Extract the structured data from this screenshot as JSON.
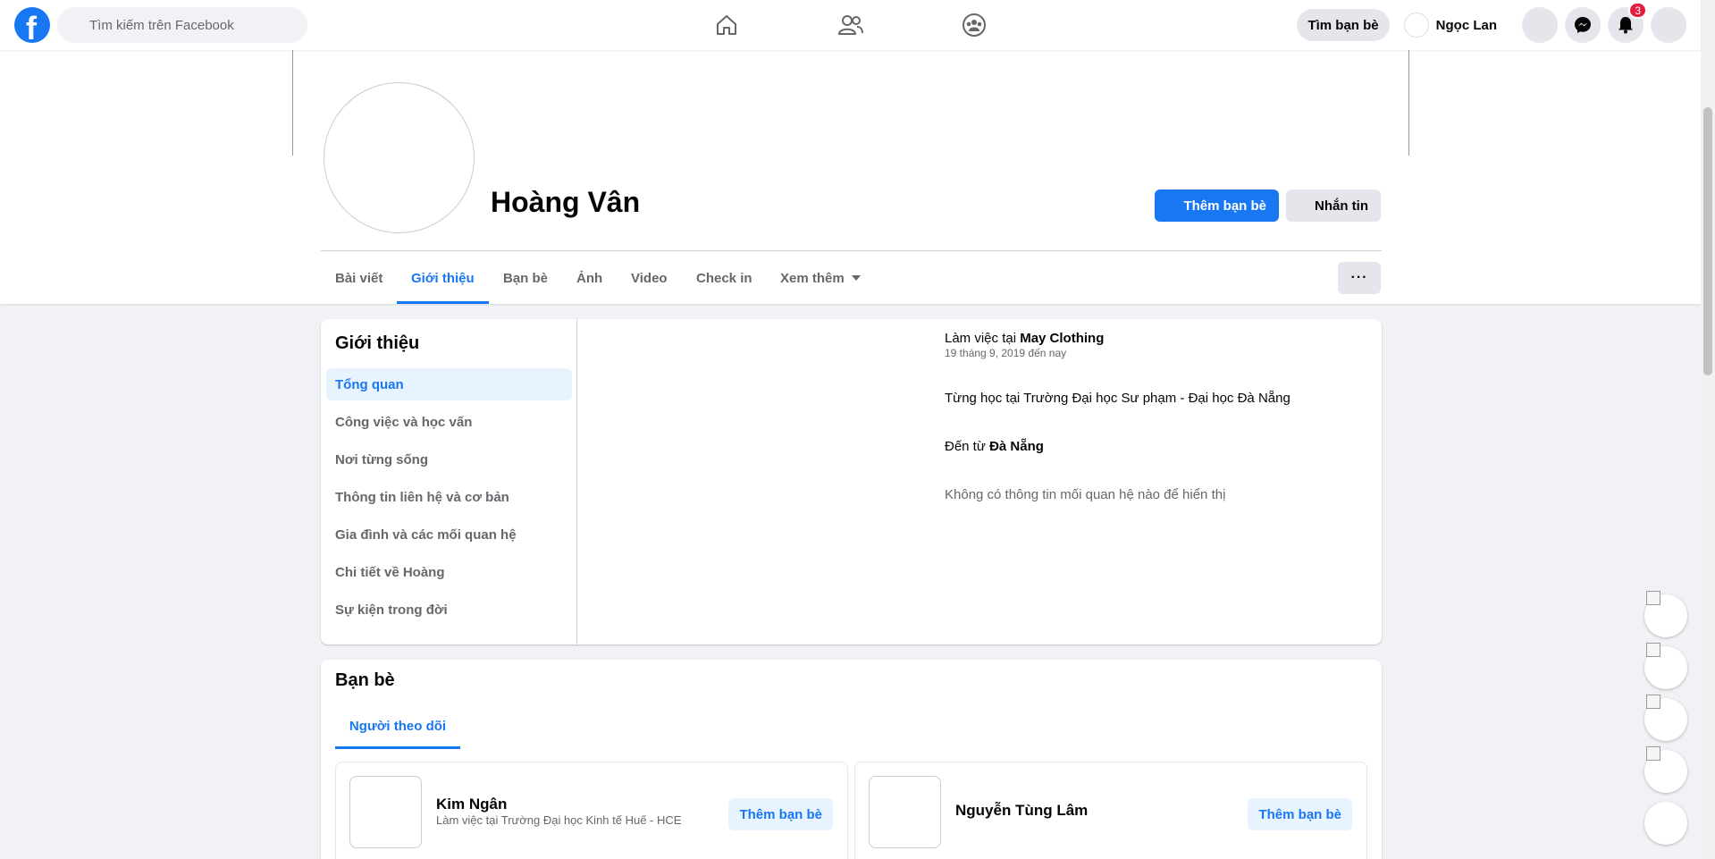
{
  "topnav": {
    "search_placeholder": "Tìm kiếm trên Facebook",
    "find_friends_label": "Tìm bạn bè",
    "user_name": "Ngọc Lan",
    "notification_count": "3",
    "icons": [
      "facebook-logo",
      "home-icon",
      "friends-icon",
      "groups-icon",
      "messenger-icon",
      "bell-icon"
    ]
  },
  "profile": {
    "name": "Hoàng Vân",
    "add_friend_label": "Thêm bạn bè",
    "message_label": "Nhắn tin",
    "tabs": [
      "Bài viết",
      "Giới thiệu",
      "Bạn bè",
      "Ảnh",
      "Video",
      "Check in",
      "Xem thêm"
    ],
    "active_tab": "Giới thiệu",
    "more_label": "···"
  },
  "intro": {
    "title": "Giới thiệu",
    "menu": [
      "Tổng quan",
      "Công việc và học vấn",
      "Nơi từng sống",
      "Thông tin liên hệ và cơ bản",
      "Gia đình và các mối quan hệ",
      "Chi tiết về Hoàng",
      "Sự kiện trong đời"
    ],
    "work_prefix": "Làm việc tại ",
    "work_place": "May Clothing",
    "work_since": "19 tháng 9, 2019 đến nay",
    "study": "Từng học tại Trường Đại học Sư phạm - Đại học Đà Nẵng",
    "from_prefix": "Đến từ ",
    "from_place": "Đà Nẵng",
    "relationship": "Không có thông tin mối quan hệ nào để hiển thị"
  },
  "friends": {
    "title": "Bạn bè",
    "tab_label": "Người theo dõi",
    "items": [
      {
        "name": "Kim Ngân",
        "sub": "Làm việc tại Trường Đại học Kinh tế Huế - HCE",
        "action": "Thêm bạn bè"
      },
      {
        "name": "Nguyễn Tùng Lâm",
        "sub": "",
        "action": "Thêm bạn bè"
      }
    ]
  },
  "colors": {
    "accent": "#1877f2",
    "page_bg": "#f0f2f5",
    "badge": "#e41e3f"
  }
}
